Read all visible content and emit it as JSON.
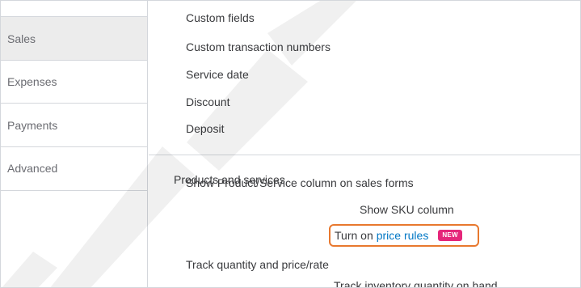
{
  "sidebar": {
    "items": [
      {
        "label": "Sales",
        "active": true
      },
      {
        "label": "Expenses",
        "active": false
      },
      {
        "label": "Payments",
        "active": false
      },
      {
        "label": "Advanced",
        "active": false
      }
    ]
  },
  "sales_form_options": [
    "Custom fields",
    "Custom transaction numbers",
    "Service date",
    "Discount",
    "Deposit"
  ],
  "products_section": {
    "label": "Products and services",
    "options": {
      "show_column": "Show Product/Service column on sales forms",
      "show_sku": "Show SKU column",
      "price_rules_prefix": "Turn on",
      "price_rules_link": "price rules",
      "new_badge": "NEW",
      "track_quantity": "Track quantity and price/rate",
      "next_partial": "Track inventory quantity on hand"
    }
  },
  "colors": {
    "link": "#0077c5",
    "highlight_border": "#e8782e",
    "badge": "#e5267a",
    "active_sidebar_bg": "#ececec"
  }
}
